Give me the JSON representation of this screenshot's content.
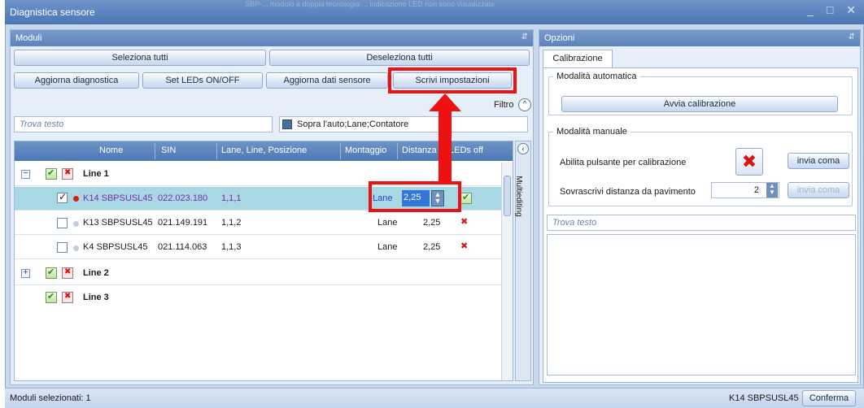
{
  "window": {
    "title": "Diagnistica sensore",
    "faint_text": "SBP-... modulo a doppia tecnologia ... indicazione LED non sono visualizzate",
    "controls": "_ □ ✕"
  },
  "modules_panel": {
    "title": "Moduli",
    "pin": "⇵",
    "buttons": {
      "select_all": "Seleziona tutti",
      "deselect_all": "Deseleziona tutti",
      "refresh_diag": "Aggiorna diagnostica",
      "set_leds": "Set LEDs ON/OFF",
      "refresh_sensor": "Aggiorna dati sensore",
      "write_settings": "Scrivi impostazioni"
    },
    "filter_label": "Filtro",
    "search_placeholder": "Trova testo",
    "combo_value": "Sopra l'auto;Lane;Contatore",
    "multiediting_label": "Multiediting",
    "columns": [
      "Nome",
      "SIN",
      "Lane, Line, Posizione",
      "Montaggio",
      "Distanza",
      "LEDs off"
    ],
    "groups": [
      "Line 1",
      "Line 2",
      "Line 3"
    ],
    "rows": [
      {
        "name": "K14 SBPSUSL45",
        "sin": "022.023.180",
        "pos": "1,1,1",
        "mount": "Lane",
        "dist": "2,25"
      },
      {
        "name": "K13 SBPSUSL45",
        "sin": "021.149.191",
        "pos": "1,1,2",
        "mount": "Lane",
        "dist": "2,25"
      },
      {
        "name": "K4 SBPSUSL45",
        "sin": "021.114.063",
        "pos": "1,1,3",
        "mount": "Lane",
        "dist": "2,25"
      }
    ]
  },
  "options_panel": {
    "title": "Opzioni",
    "pin": "⇵",
    "tab": "Calibrazione",
    "auto_group": "Modalità automatica",
    "auto_button": "Avvia calibrazione",
    "manual_group": "Modalità manuale",
    "enable_label": "Abilita pulsante per calibrazione",
    "send_button": "invia coma",
    "floor_label": "Sovrascrivi distanza da pavimento",
    "floor_value": "2",
    "send_button_2": "invia coma",
    "search_placeholder": "Trova testo"
  },
  "status": {
    "selected": "Moduli selezionati: 1",
    "current": "K14 SBPSUSL45",
    "confirm": "Conferma"
  },
  "colors": {
    "accent": "#ee1111",
    "header_blue": "#4c78b5",
    "selected_row": "#a9d8e5"
  }
}
